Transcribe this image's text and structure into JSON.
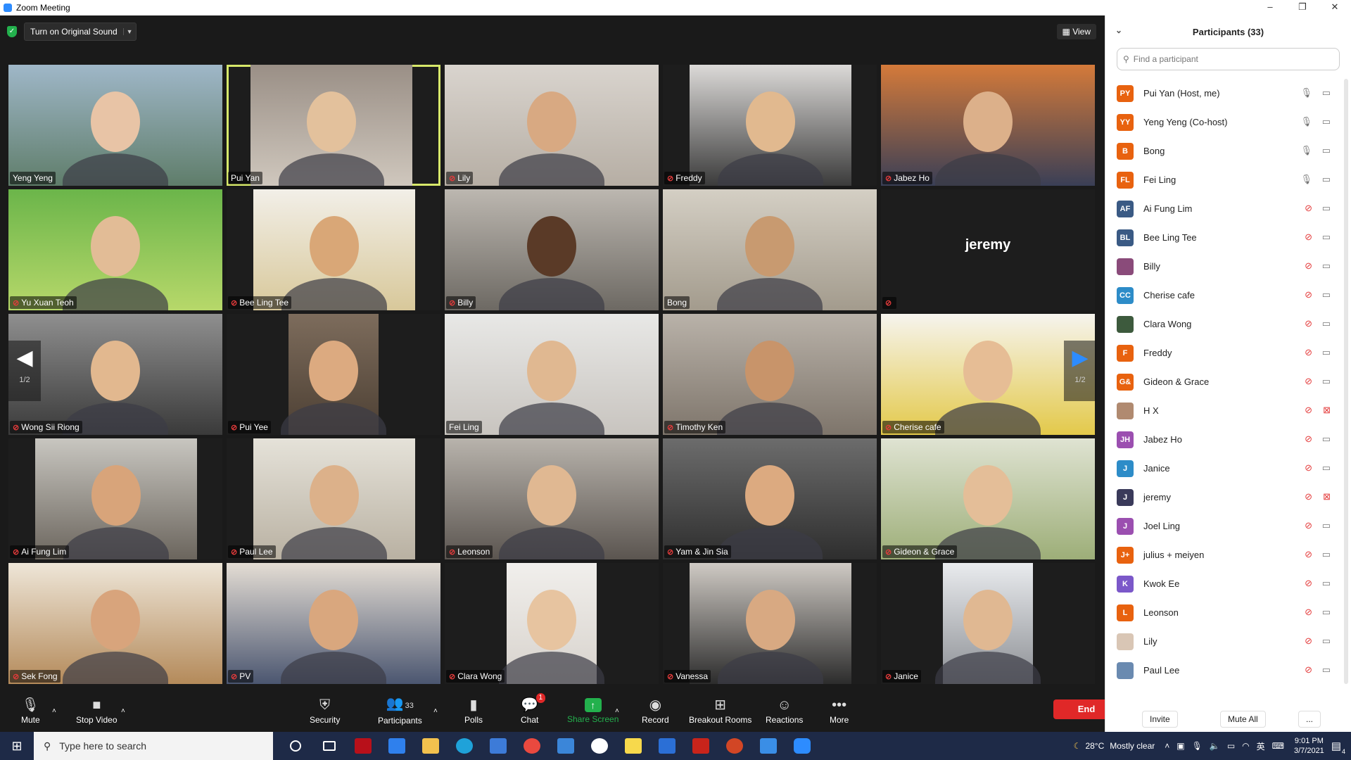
{
  "window": {
    "title": "Zoom Meeting",
    "controls": [
      "–",
      "❐",
      "✕"
    ]
  },
  "meeting": {
    "original_sound_label": "Turn on Original Sound",
    "view_label": "View",
    "page_indicator": "1/2",
    "big_name_tile": "jeremy",
    "tiles": [
      {
        "name": "Yeng Yeng",
        "muted": false
      },
      {
        "name": "Pui Yan",
        "muted": false,
        "active": true
      },
      {
        "name": "Lily",
        "muted": true
      },
      {
        "name": "Freddy",
        "muted": true
      },
      {
        "name": "Jabez Ho",
        "muted": true
      },
      {
        "name": "Yu Xuan Teoh",
        "muted": true
      },
      {
        "name": "Bee Ling Tee",
        "muted": true
      },
      {
        "name": "Billy",
        "muted": true
      },
      {
        "name": "Bong",
        "muted": false
      },
      {
        "name": "",
        "muted": true
      },
      {
        "name": "Wong Sii Riong",
        "muted": true
      },
      {
        "name": "Pui Yee",
        "muted": true
      },
      {
        "name": "Fei Ling",
        "muted": false
      },
      {
        "name": "Timothy Ken",
        "muted": true
      },
      {
        "name": "Cherise cafe",
        "muted": true
      },
      {
        "name": "Ai Fung Lim",
        "muted": true
      },
      {
        "name": "Paul Lee",
        "muted": true
      },
      {
        "name": "Leonson",
        "muted": true
      },
      {
        "name": "Yam & Jin Sia",
        "muted": true
      },
      {
        "name": "Gideon & Grace",
        "muted": true
      },
      {
        "name": "Sek Fong",
        "muted": true
      },
      {
        "name": "PV",
        "muted": true
      },
      {
        "name": "Clara Wong",
        "muted": true
      },
      {
        "name": "Vanessa",
        "muted": true
      },
      {
        "name": "Janice",
        "muted": true
      }
    ]
  },
  "toolbar": {
    "mute": "Mute",
    "stop_video": "Stop Video",
    "security": "Security",
    "participants": "Participants",
    "participants_count": "33",
    "polls": "Polls",
    "chat": "Chat",
    "chat_badge": "1",
    "share_screen": "Share Screen",
    "record": "Record",
    "breakout_rooms": "Breakout Rooms",
    "reactions": "Reactions",
    "more": "More",
    "end": "End"
  },
  "panel": {
    "title": "Participants (33)",
    "search_placeholder": "Find a participant",
    "invite": "Invite",
    "mute_all": "Mute All",
    "more": "...",
    "participants": [
      {
        "initials": "PY",
        "name": "Pui Yan (Host, me)",
        "color": "#e8620f",
        "mic_muted": false,
        "cam_off": false
      },
      {
        "initials": "YY",
        "name": "Yeng Yeng (Co-host)",
        "color": "#e8620f",
        "mic_muted": false,
        "cam_off": false
      },
      {
        "initials": "B",
        "name": "Bong",
        "color": "#e8620f",
        "mic_muted": false,
        "cam_off": false
      },
      {
        "initials": "FL",
        "name": "Fei Ling",
        "color": "#e8620f",
        "mic_muted": false,
        "cam_off": false
      },
      {
        "initials": "AF",
        "name": "Ai Fung Lim",
        "color": "#3a5a84",
        "mic_muted": true,
        "cam_off": false
      },
      {
        "initials": "BL",
        "name": "Bee Ling Tee",
        "color": "#3a5a84",
        "mic_muted": true,
        "cam_off": false
      },
      {
        "initials": "",
        "name": "Billy",
        "color": "#8a4b7a",
        "mic_muted": true,
        "cam_off": false
      },
      {
        "initials": "CC",
        "name": "Cherise cafe",
        "color": "#2d8cc8",
        "mic_muted": true,
        "cam_off": false
      },
      {
        "initials": "",
        "name": "Clara Wong",
        "color": "#3d5a3d",
        "mic_muted": true,
        "cam_off": false
      },
      {
        "initials": "F",
        "name": "Freddy",
        "color": "#e8620f",
        "mic_muted": true,
        "cam_off": false
      },
      {
        "initials": "G&",
        "name": "Gideon & Grace",
        "color": "#e8620f",
        "mic_muted": true,
        "cam_off": false
      },
      {
        "initials": "",
        "name": "H X",
        "color": "#b08a70",
        "mic_muted": true,
        "cam_off": true
      },
      {
        "initials": "JH",
        "name": "Jabez Ho",
        "color": "#9b4fb0",
        "mic_muted": true,
        "cam_off": false
      },
      {
        "initials": "J",
        "name": "Janice",
        "color": "#2d8cc8",
        "mic_muted": true,
        "cam_off": false
      },
      {
        "initials": "J",
        "name": "jeremy",
        "color": "#3a3a5a",
        "mic_muted": true,
        "cam_off": true
      },
      {
        "initials": "J",
        "name": "Joel Ling",
        "color": "#9b4fb0",
        "mic_muted": true,
        "cam_off": false
      },
      {
        "initials": "J+",
        "name": "julius + meiyen",
        "color": "#e8620f",
        "mic_muted": true,
        "cam_off": false
      },
      {
        "initials": "K",
        "name": "Kwok Ee",
        "color": "#7b58c9",
        "mic_muted": true,
        "cam_off": false
      },
      {
        "initials": "L",
        "name": "Leonson",
        "color": "#e8620f",
        "mic_muted": true,
        "cam_off": false
      },
      {
        "initials": "",
        "name": "Lily",
        "color": "#d9c6b5",
        "mic_muted": true,
        "cam_off": false
      },
      {
        "initials": "",
        "name": "Paul Lee",
        "color": "#6a8ab0",
        "mic_muted": true,
        "cam_off": false
      }
    ]
  },
  "taskbar": {
    "search_placeholder": "Type here to search",
    "weather_temp": "28°C",
    "weather_desc": "Mostly clear",
    "time": "9:01 PM",
    "date": "3/7/2021",
    "notification_count": "4"
  },
  "colors": {
    "active_speaker_border": "#d7e86a",
    "end_button": "#e02828",
    "share_screen": "#23b14d",
    "muted_mic": "#e43b3b"
  }
}
